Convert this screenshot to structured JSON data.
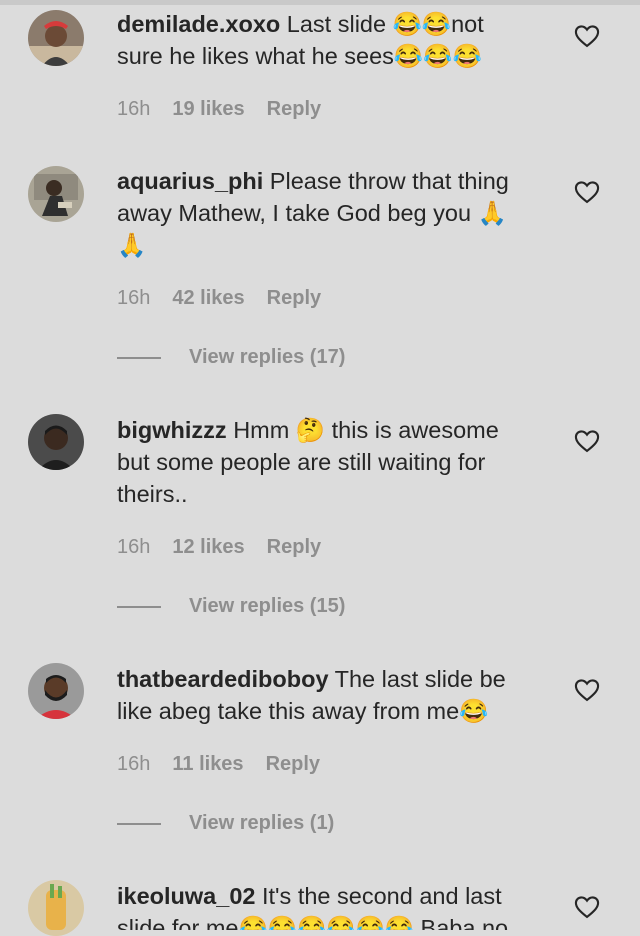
{
  "comments": [
    {
      "username": "demilade.xoxo",
      "text": "Last slide 😂😂not sure he likes what he sees😂😂😂",
      "time": "16h",
      "likes": "19 likes",
      "reply": "Reply"
    },
    {
      "username": "aquarius_phi",
      "text": "Please throw that thing away Mathew, I take God beg you 🙏 🙏",
      "time": "16h",
      "likes": "42 likes",
      "reply": "Reply",
      "view_replies": "View replies (17)"
    },
    {
      "username": "bigwhizzz",
      "text": "Hmm 🤔 this is awesome but some people are still waiting for theirs..",
      "time": "16h",
      "likes": "12 likes",
      "reply": "Reply",
      "view_replies": "View replies (15)"
    },
    {
      "username": "thatbeardediboboy",
      "text": "The last slide be like abeg take this away from me😂",
      "time": "16h",
      "likes": "11 likes",
      "reply": "Reply",
      "view_replies": "View replies (1)"
    },
    {
      "username": "ikeoluwa_02",
      "text": "It's the second and last slide for me😂😂😂😂😂😂 Baba no"
    }
  ],
  "colors": {
    "background": "#dcdcdc",
    "text": "#262626",
    "muted": "#8e8e8e"
  },
  "icons": {
    "like": "heart-outline-icon"
  }
}
